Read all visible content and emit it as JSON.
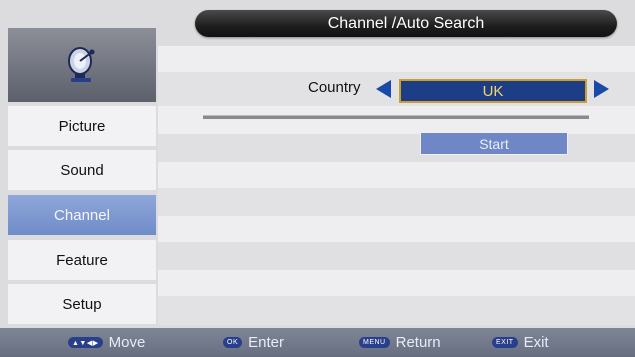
{
  "header": {
    "title": "Channel /Auto Search"
  },
  "sidebar": {
    "icon": "satellite-dish-icon",
    "items": [
      {
        "label": "Picture",
        "active": false
      },
      {
        "label": "Sound",
        "active": false
      },
      {
        "label": "Channel",
        "active": true
      },
      {
        "label": "Feature",
        "active": false
      },
      {
        "label": "Setup",
        "active": false
      }
    ]
  },
  "main": {
    "country_label": "Country",
    "country_value": "UK",
    "start_label": "Start"
  },
  "footer": {
    "move_key": "▲▼◀▶",
    "move_label": "Move",
    "enter_key": "OK",
    "enter_label": "Enter",
    "return_key": "MENU",
    "return_label": "Return",
    "exit_key": "EXIT",
    "exit_label": "Exit"
  },
  "colors": {
    "accent_selected": "#6f8cc9",
    "country_box": "#1d3d87",
    "country_border": "#c9a030",
    "arrows": "#1a4aa8"
  }
}
